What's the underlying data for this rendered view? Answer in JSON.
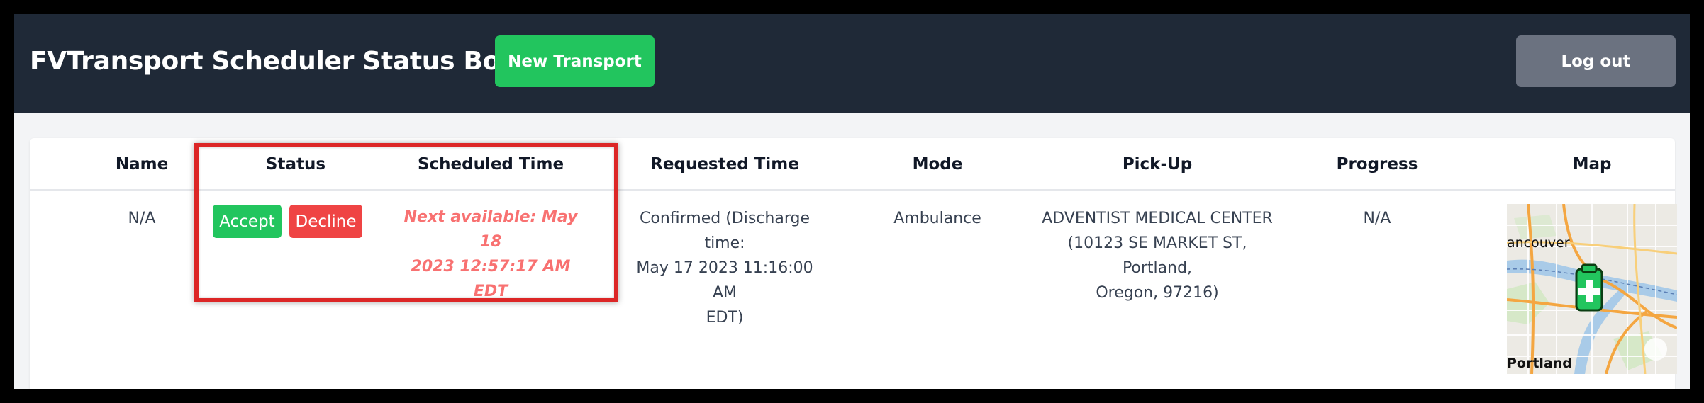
{
  "header": {
    "title": "FVTransport Scheduler Status Board",
    "new_button": "New Transport",
    "logout_button": "Log out"
  },
  "table": {
    "columns": [
      "Name",
      "Status",
      "Scheduled Time",
      "Requested Time",
      "Mode",
      "Pick-Up",
      "Progress",
      "Map"
    ],
    "rows": [
      {
        "name": "N/A",
        "status_accept": "Accept",
        "status_decline": "Decline",
        "scheduled_line1": "Next available: May 18",
        "scheduled_line2": "2023 12:57:17 AM EDT",
        "requested_line1": "Confirmed (Discharge time:",
        "requested_line2": "May 17 2023 11:16:00 AM",
        "requested_line3": "EDT)",
        "mode": "Ambulance",
        "pickup_line1": "ADVENTIST MEDICAL CENTER",
        "pickup_line2": "(10123 SE MARKET ST, Portland,",
        "pickup_line3": "Oregon, 97216)",
        "progress": "N/A",
        "map_label_top": "ancouver",
        "map_label_bottom": "Portland"
      }
    ]
  },
  "colors": {
    "header_bg": "#1f2937",
    "accent_green": "#22c55e",
    "danger_red": "#ef4444",
    "muted_gray": "#6b7280",
    "highlight_red": "#dc2626",
    "scheduled_text": "#f87171"
  },
  "icons": {
    "map_marker": "ambulance-marker-icon"
  }
}
